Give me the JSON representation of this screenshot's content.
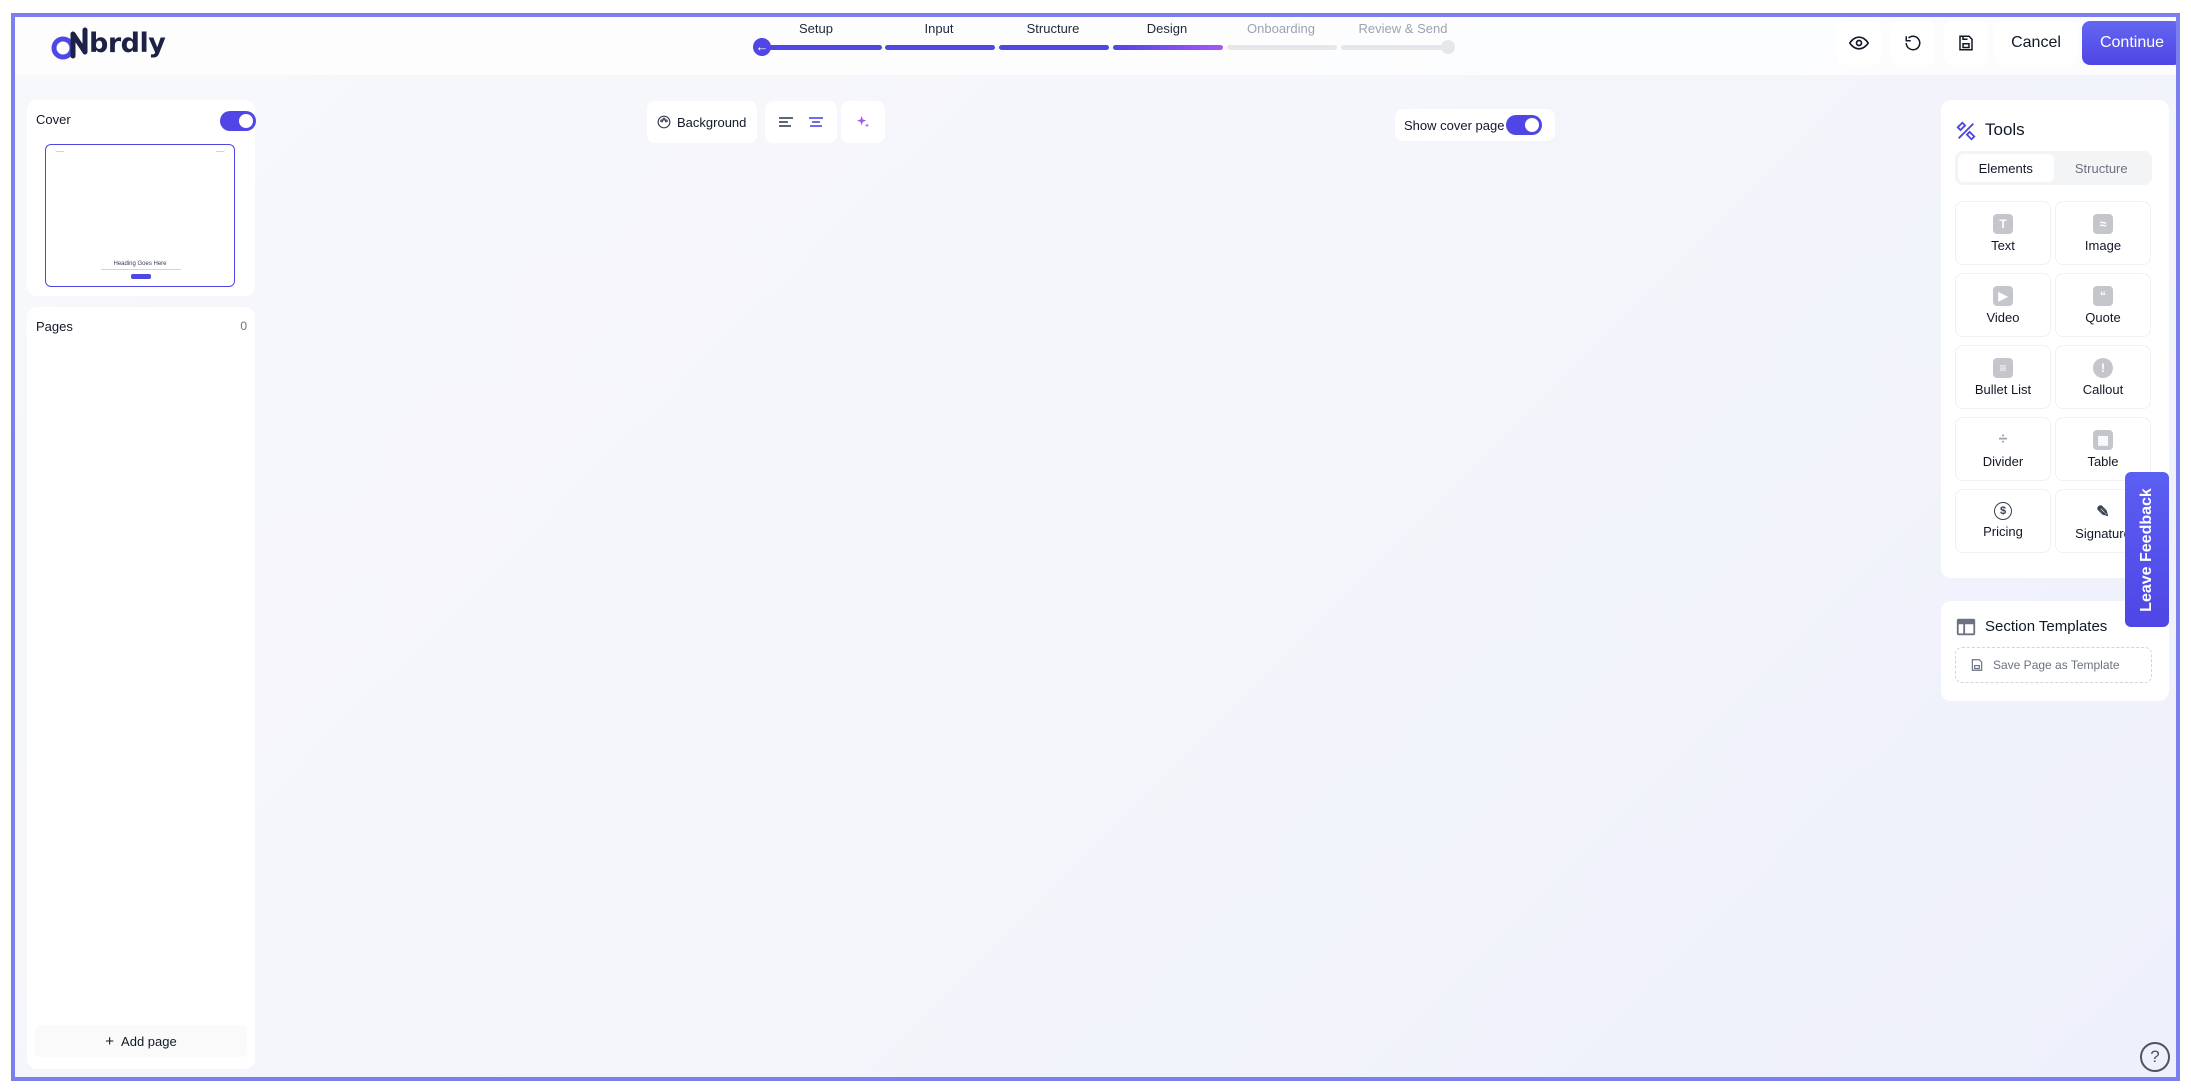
{
  "app": {
    "logo_text": "brdly",
    "logo_icon": "onbrdly-logo"
  },
  "stepper": {
    "steps": [
      {
        "label": "Setup",
        "state": "done"
      },
      {
        "label": "Input",
        "state": "done"
      },
      {
        "label": "Structure",
        "state": "done"
      },
      {
        "label": "Design",
        "state": "current"
      },
      {
        "label": "Onboarding",
        "state": "todo"
      },
      {
        "label": "Review & Send",
        "state": "todo"
      }
    ]
  },
  "header": {
    "preview_icon": "eye-icon",
    "undo_icon": "undo-icon",
    "save_icon": "save-icon",
    "cancel_label": "Cancel",
    "continue_label": "Continue"
  },
  "sidebar": {
    "cover": {
      "label": "Cover",
      "enabled": true,
      "thumbnail_heading": "Heading Goes Here"
    },
    "pages": {
      "label": "Pages",
      "count": "0",
      "add_label": "Add page"
    }
  },
  "editor": {
    "background_label": "Background",
    "show_cover_label": "Show cover page",
    "show_cover_enabled": true
  },
  "tools": {
    "title": "Tools",
    "tabs": [
      {
        "label": "Elements",
        "active": true
      },
      {
        "label": "Structure",
        "active": false
      }
    ],
    "elements": [
      {
        "label": "Text",
        "icon": "text-icon",
        "glyph": "T"
      },
      {
        "label": "Image",
        "icon": "image-icon",
        "glyph": "≈"
      },
      {
        "label": "Video",
        "icon": "video-icon",
        "glyph": "▶"
      },
      {
        "label": "Quote",
        "icon": "quote-icon",
        "glyph": "“"
      },
      {
        "label": "Bullet List",
        "icon": "bullet-list-icon",
        "glyph": "≡"
      },
      {
        "label": "Callout",
        "icon": "callout-icon",
        "glyph": "!"
      },
      {
        "label": "Divider",
        "icon": "divider-icon",
        "glyph": "÷"
      },
      {
        "label": "Table",
        "icon": "table-icon",
        "glyph": "▦"
      },
      {
        "label": "Pricing",
        "icon": "pricing-icon",
        "glyph": "$"
      },
      {
        "label": "Signature",
        "icon": "signature-icon",
        "glyph": "✎"
      }
    ]
  },
  "templates": {
    "title": "Section Templates",
    "save_label": "Save Page as Template"
  },
  "feedback": {
    "label": "Leave Feedback"
  },
  "help": {
    "glyph": "?"
  },
  "colors": {
    "accent": "#4f46e5",
    "accent_gradient_end": "#a855f7",
    "track": "#e5e7eb"
  }
}
